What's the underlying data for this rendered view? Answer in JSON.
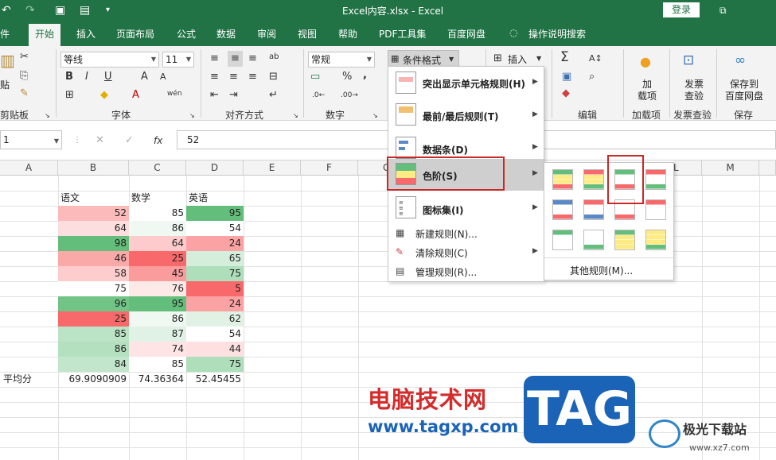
{
  "window": {
    "title": "Excel内容.xlsx  -  Excel",
    "login": "登录",
    "restore_icon": "restore-icon"
  },
  "quick_access": [
    "undo-icon",
    "redo-icon",
    "save-icon",
    "print-preview-icon",
    "customize-icon"
  ],
  "tabs": [
    "件",
    "开始",
    "插入",
    "页面布局",
    "公式",
    "数据",
    "审阅",
    "视图",
    "帮助",
    "PDF工具集",
    "百度网盘",
    "操作说明搜索"
  ],
  "active_tab": "开始",
  "ribbon": {
    "paste": "贴",
    "clipboard": "剪贴板",
    "font_name": "等线",
    "font_size": "11",
    "font_group": "字体",
    "align_group": "对齐方式",
    "number_format": "常规",
    "number_group": "数字",
    "cond_format": "条件格式",
    "insert": "插入",
    "edit_group": "编辑",
    "addin_btn": "加\n载项",
    "addin_group": "加载项",
    "invoice_btn": "发票\n查验",
    "invoice_group": "发票查验",
    "save_baidu_btn": "保存到\n百度网盘",
    "save_group": "保存",
    "bold": "B",
    "italic": "I",
    "underline": "U",
    "grow": "A",
    "shrink": "A",
    "wen": "wén",
    "percent": "%",
    "comma": ",",
    "sigma": "Σ"
  },
  "formula_bar": {
    "name_box": "1",
    "fx": "fx",
    "value": "52"
  },
  "columns": [
    "A",
    "B",
    "C",
    "D",
    "E",
    "F",
    "G",
    "L",
    "M"
  ],
  "headers": [
    "语文",
    "数学",
    "英语"
  ],
  "rows": [
    [
      52,
      85,
      95
    ],
    [
      64,
      86,
      54
    ],
    [
      98,
      64,
      24
    ],
    [
      46,
      25,
      65
    ],
    [
      58,
      45,
      75
    ],
    [
      75,
      76,
      5
    ],
    [
      96,
      95,
      24
    ],
    [
      25,
      86,
      62
    ],
    [
      85,
      87,
      54
    ],
    [
      86,
      74,
      44
    ],
    [
      84,
      85,
      75
    ]
  ],
  "avg_label": "平均分",
  "averages": [
    "69.9090909",
    "74.36364",
    "52.45455"
  ],
  "cf_menu": [
    {
      "label": "突出显示单元格规则(H)",
      "arrow": true
    },
    {
      "label": "最前/最后规则(T)",
      "arrow": true
    },
    {
      "label": "数据条(D)",
      "arrow": true
    },
    {
      "label": "色阶(S)",
      "arrow": true
    },
    {
      "label": "图标集(I)",
      "arrow": true
    },
    {
      "label": "新建规则(N)...",
      "arrow": false
    },
    {
      "label": "清除规则(C)",
      "arrow": true
    },
    {
      "label": "管理规则(R)...",
      "arrow": false
    }
  ],
  "more_rules": "其他规则(M)...",
  "colors": {
    "excel_green": "#217346",
    "highlight": "#c82828",
    "red": "#f8696b",
    "green": "#63be7b",
    "yellow": "#ffeb84",
    "blue": "#5a8ac6",
    "white": "#ffffff"
  },
  "watermark": {
    "cn": "电脑技术网",
    "url": "www.tagxp.com",
    "tag": "TAG",
    "site_cn": "极光下载站",
    "site_url": "www.xz7.com"
  }
}
